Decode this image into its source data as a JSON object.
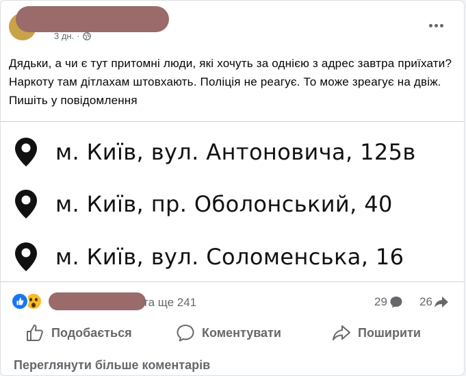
{
  "post": {
    "meta": {
      "time": "3 дн.",
      "separator": "·"
    },
    "text": "Дядьки, а чи є тут притомні люди, які хочуть за однією з адрес завтра приїхати? Наркоту там дітлахам штовхають. Поліція не реагує. То може зреагує на двіж. Пишіть у повідомлення",
    "addresses": [
      "м. Київ, вул. Антоновича, 125в",
      "м. Київ, пр. Оболонський, 40",
      "м. Київ, вул. Соломенська, 16"
    ]
  },
  "stats": {
    "reactions_text": "та ще 241",
    "comments": "29",
    "shares": "26"
  },
  "actions": {
    "like": "Подобається",
    "comment": "Коментувати",
    "share": "Поширити"
  },
  "footer": {
    "more_comments": "Переглянути більше коментарів"
  },
  "colors": {
    "like_blue": "#1877f2",
    "wow_yellow": "#f7b928",
    "muted": "#65676b",
    "redaction": "#9b6a6a"
  },
  "icons": {
    "more": "more-horizontal-icon",
    "globe": "globe-icon",
    "pin": "map-pin-icon",
    "like": "thumbs-up-icon",
    "comment": "comment-bubble-icon",
    "share": "share-arrow-icon"
  }
}
